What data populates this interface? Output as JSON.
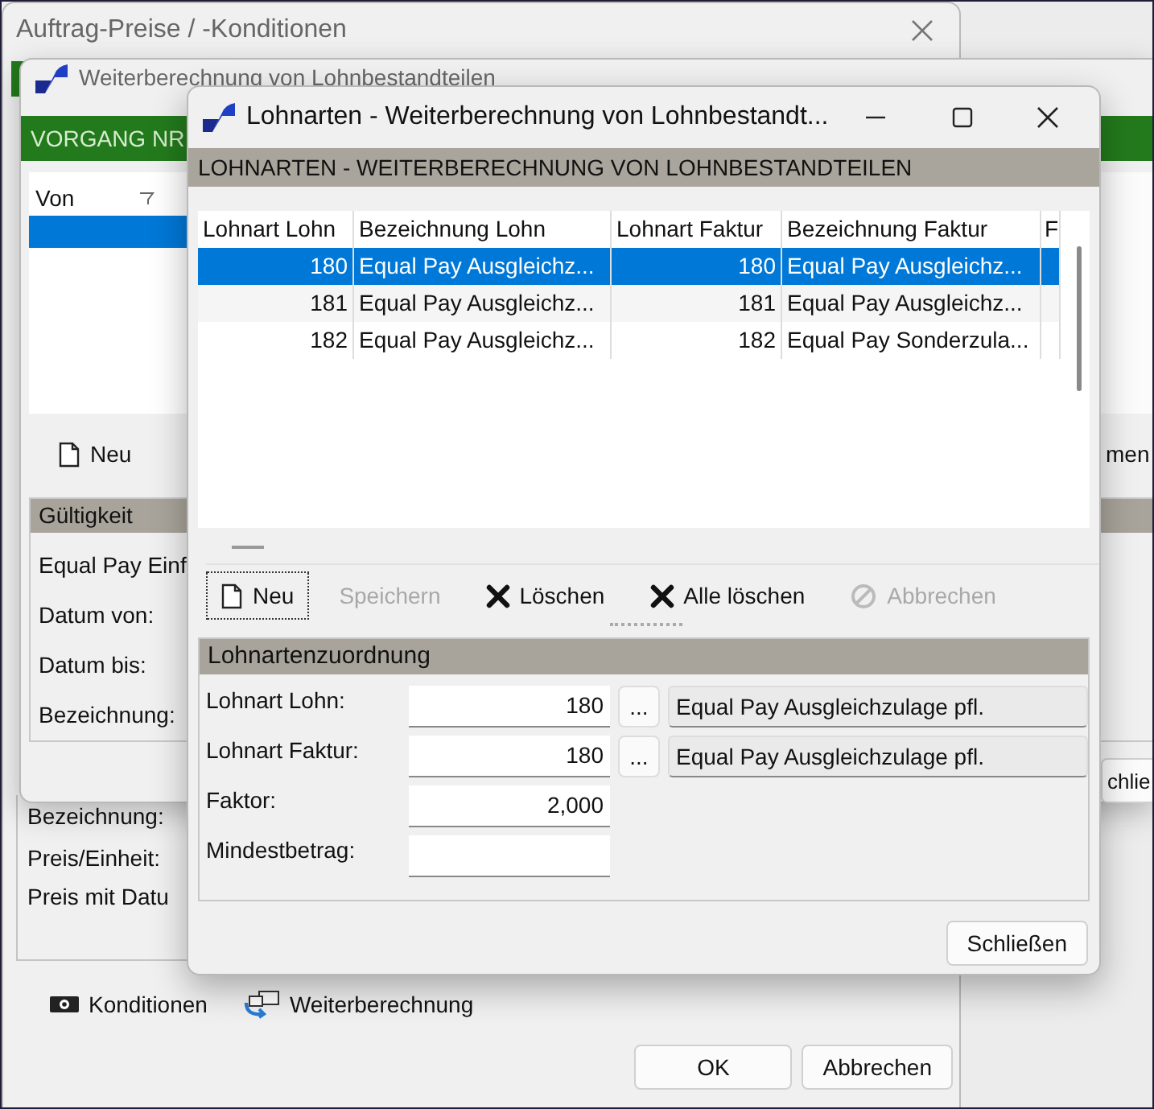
{
  "back_window": {
    "title": "Auftrag-Preise / -Konditionen",
    "labels": [
      "Bezeichnung:",
      "Preis/Einheit:",
      "Preis mit Datu"
    ],
    "links": [
      {
        "label": "Konditionen",
        "kind": "money"
      },
      {
        "label": "Weiterberechnung",
        "kind": "transfer"
      }
    ],
    "buttons": [
      "OK",
      "Abbrechen"
    ]
  },
  "middle_window": {
    "title": "Weiterberechnung von Lohnbestandteilen",
    "banner": "VORGANG NR",
    "list": {
      "column": "Von",
      "rows": [
        {
          "selected": true
        }
      ]
    },
    "new_button": "Neu",
    "right_button": "men",
    "group": {
      "title": "Gültigkeit",
      "labels": [
        "Equal Pay Einf",
        "Datum von:",
        "Datum bis:",
        "Bezeichnung:"
      ]
    },
    "close_button": "chlie"
  },
  "front_window": {
    "title": "Lohnarten - Weiterberechnung von Lohnbestandt...",
    "banner": "LOHNARTEN - WEITERBERECHNUNG VON LOHNBESTANDTEILEN",
    "table": {
      "columns": [
        "Lohnart Lohn",
        "Bezeichnung Lohn",
        "Lohnart Faktur",
        "Bezeichnung Faktur",
        "F"
      ],
      "rows": [
        {
          "cells": [
            "180",
            "Equal Pay Ausgleichz...",
            "180",
            "Equal Pay Ausgleichz..."
          ],
          "selected": true
        },
        {
          "cells": [
            "181",
            "Equal Pay Ausgleichz...",
            "181",
            "Equal Pay Ausgleichz..."
          ],
          "selected": false
        },
        {
          "cells": [
            "182",
            "Equal Pay Ausgleichz...",
            "182",
            "Equal Pay Sonderzula..."
          ],
          "selected": false
        }
      ]
    },
    "toolbar": [
      {
        "label": "Neu",
        "kind": "new",
        "disabled": false,
        "focused": true
      },
      {
        "label": "Speichern",
        "kind": "save",
        "disabled": true,
        "focused": false
      },
      {
        "label": "Löschen",
        "kind": "delete",
        "disabled": false,
        "focused": false
      },
      {
        "label": "Alle löschen",
        "kind": "delete",
        "disabled": false,
        "focused": false
      },
      {
        "label": "Abbrechen",
        "kind": "cancel",
        "disabled": true,
        "focused": false
      }
    ],
    "group": {
      "title": "Lohnartenzuordnung",
      "rows": [
        {
          "label": "Lohnart Lohn:",
          "value": "180",
          "lookup": "...",
          "description": "Equal Pay Ausgleichzulage pfl."
        },
        {
          "label": "Lohnart Faktur:",
          "value": "180",
          "lookup": "...",
          "description": "Equal Pay Ausgleichzulage pfl."
        },
        {
          "label": "Faktor:",
          "value": "2,000"
        },
        {
          "label": "Mindestbetrag:"
        }
      ]
    },
    "close_button": "Schließen"
  }
}
